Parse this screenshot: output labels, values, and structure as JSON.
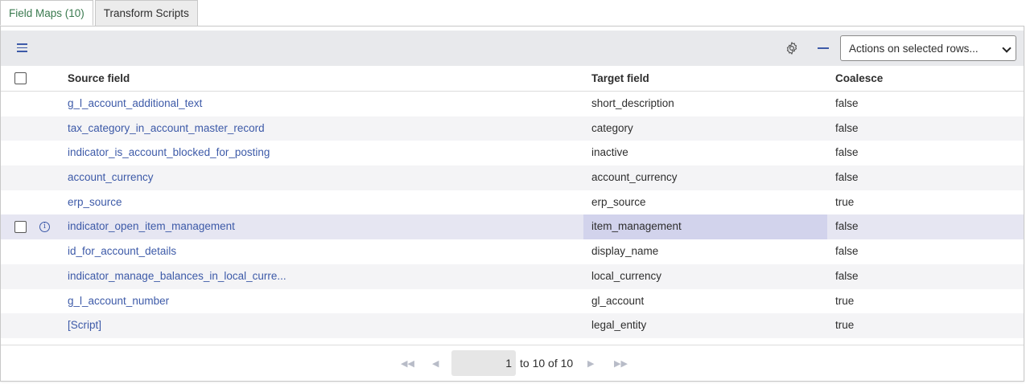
{
  "tabs": [
    {
      "label": "Field Maps (10)",
      "active": true
    },
    {
      "label": "Transform Scripts",
      "active": false
    }
  ],
  "toolbar": {
    "menu_icon": "hamburger-icon",
    "settings_icon": "gear-icon",
    "collapse_icon": "minus-icon",
    "actions_select": "Actions on selected rows..."
  },
  "table": {
    "columns": [
      "Source field",
      "Target field",
      "Coalesce"
    ],
    "rows": [
      {
        "source": "g_l_account_additional_text",
        "target": "short_description",
        "coalesce": "false"
      },
      {
        "source": "tax_category_in_account_master_record",
        "target": "category",
        "coalesce": "false"
      },
      {
        "source": "indicator_is_account_blocked_for_posting",
        "target": "inactive",
        "coalesce": "false"
      },
      {
        "source": "account_currency",
        "target": "account_currency",
        "coalesce": "false"
      },
      {
        "source": "erp_source",
        "target": "erp_source",
        "coalesce": "true"
      },
      {
        "source": "indicator_open_item_management",
        "target": "item_management",
        "coalesce": "false"
      },
      {
        "source": "id_for_account_details",
        "target": "display_name",
        "coalesce": "false"
      },
      {
        "source": "indicator_manage_balances_in_local_curre...",
        "target": "local_currency",
        "coalesce": "false"
      },
      {
        "source": "g_l_account_number",
        "target": "gl_account",
        "coalesce": "true"
      },
      {
        "source": "[Script]",
        "target": "legal_entity",
        "coalesce": "true"
      }
    ]
  },
  "pagination": {
    "current_page": "1",
    "range_text": "to 10 of 10"
  },
  "colors": {
    "link": "#3d5aa8",
    "active_tab": "#3a7a4f",
    "toolbar_bg": "#e8e9ec",
    "row_hover": "#e6e6f2",
    "cell_highlight": "#d2d3ec"
  }
}
